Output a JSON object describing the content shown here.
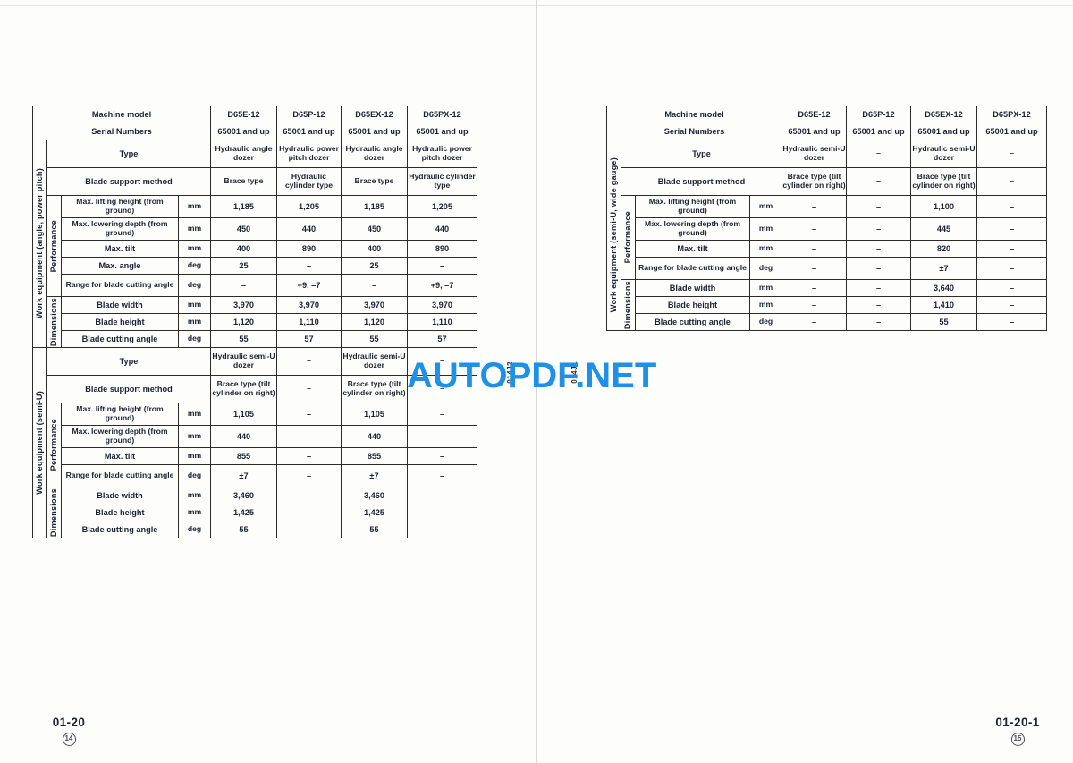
{
  "document": {
    "watermark": "AUTOPDF.NET",
    "watermark_color": "#1e90e8",
    "sheet_code_left": "014J2",
    "sheet_code_right": "014J1"
  },
  "left_page": {
    "footer_page": "01-20",
    "footer_revision": "14",
    "table": {
      "header_rows": [
        {
          "label": "Machine model",
          "values": [
            "D65E-12",
            "D65P-12",
            "D65EX-12",
            "D65PX-12"
          ]
        },
        {
          "label": "Serial Numbers",
          "values": [
            "65001 and up",
            "65001 and up",
            "65001 and up",
            "65001 and up"
          ]
        }
      ],
      "sections": [
        {
          "group_label": "Work equipment (angle, power pitch)",
          "type_row": {
            "label": "Type",
            "values": [
              "Hydraulic angle dozer",
              "Hydraulic power pitch dozer",
              "Hydraulic angle dozer",
              "Hydraulic power pitch dozer"
            ]
          },
          "support_row": {
            "label": "Blade support method",
            "values": [
              "Brace type",
              "Hydraulic cylinder type",
              "Brace type",
              "Hydraulic cylinder type"
            ]
          },
          "subsections": [
            {
              "label": "Performance",
              "rows": [
                {
                  "label": "Max. lifting height (from ground)",
                  "unit": "mm",
                  "values": [
                    "1,185",
                    "1,205",
                    "1,185",
                    "1,205"
                  ]
                },
                {
                  "label": "Max. lowering depth (from ground)",
                  "unit": "mm",
                  "values": [
                    "450",
                    "440",
                    "450",
                    "440"
                  ]
                },
                {
                  "label": "Max. tilt",
                  "unit": "mm",
                  "values": [
                    "400",
                    "890",
                    "400",
                    "890"
                  ]
                },
                {
                  "label": "Max. angle",
                  "unit": "deg",
                  "values": [
                    "25",
                    "–",
                    "25",
                    "–"
                  ]
                },
                {
                  "label": "Range for blade cutting angle",
                  "unit": "deg",
                  "values": [
                    "–",
                    "+9, –7",
                    "–",
                    "+9, –7"
                  ]
                }
              ]
            },
            {
              "label": "Dimensions",
              "rows": [
                {
                  "label": "Blade width",
                  "unit": "mm",
                  "values": [
                    "3,970",
                    "3,970",
                    "3,970",
                    "3,970"
                  ]
                },
                {
                  "label": "Blade height",
                  "unit": "mm",
                  "values": [
                    "1,120",
                    "1,110",
                    "1,120",
                    "1,110"
                  ]
                },
                {
                  "label": "Blade cutting angle",
                  "unit": "deg",
                  "values": [
                    "55",
                    "57",
                    "55",
                    "57"
                  ]
                }
              ]
            }
          ]
        },
        {
          "group_label": "Work equipment (semi-U)",
          "type_row": {
            "label": "Type",
            "values": [
              "Hydraulic semi-U dozer",
              "–",
              "Hydraulic semi-U dozer",
              "–"
            ]
          },
          "support_row": {
            "label": "Blade support method",
            "values": [
              "Brace type (tilt cylinder on right)",
              "–",
              "Brace type (tilt cylinder on right)",
              "–"
            ]
          },
          "subsections": [
            {
              "label": "Performance",
              "rows": [
                {
                  "label": "Max. lifting height (from ground)",
                  "unit": "mm",
                  "values": [
                    "1,105",
                    "–",
                    "1,105",
                    "–"
                  ]
                },
                {
                  "label": "Max. lowering depth (from ground)",
                  "unit": "mm",
                  "values": [
                    "440",
                    "–",
                    "440",
                    "–"
                  ]
                },
                {
                  "label": "Max. tilt",
                  "unit": "mm",
                  "values": [
                    "855",
                    "–",
                    "855",
                    "–"
                  ]
                },
                {
                  "label": "Range for blade cutting angle",
                  "unit": "deg",
                  "values": [
                    "±7",
                    "–",
                    "±7",
                    "–"
                  ]
                }
              ]
            },
            {
              "label": "Dimensions",
              "rows": [
                {
                  "label": "Blade width",
                  "unit": "mm",
                  "values": [
                    "3,460",
                    "–",
                    "3,460",
                    "–"
                  ]
                },
                {
                  "label": "Blade height",
                  "unit": "mm",
                  "values": [
                    "1,425",
                    "–",
                    "1,425",
                    "–"
                  ]
                },
                {
                  "label": "Blade cutting angle",
                  "unit": "deg",
                  "values": [
                    "55",
                    "–",
                    "55",
                    "–"
                  ]
                }
              ]
            }
          ]
        }
      ]
    }
  },
  "right_page": {
    "footer_page": "01-20-1",
    "footer_revision": "15",
    "table": {
      "header_rows": [
        {
          "label": "Machine model",
          "values": [
            "D65E-12",
            "D65P-12",
            "D65EX-12",
            "D65PX-12"
          ]
        },
        {
          "label": "Serial Numbers",
          "values": [
            "65001 and up",
            "65001 and up",
            "65001 and up",
            "65001 and up"
          ]
        }
      ],
      "sections": [
        {
          "group_label": "Work equipment (semi-U, wide gauge)",
          "type_row": {
            "label": "Type",
            "values": [
              "Hydraulic semi-U dozer",
              "–",
              "Hydraulic semi-U dozer",
              "–"
            ]
          },
          "support_row": {
            "label": "Blade support method",
            "values": [
              "Brace type (tilt cylinder on right)",
              "–",
              "Brace type (tilt cylinder on right)",
              "–"
            ]
          },
          "subsections": [
            {
              "label": "Performance",
              "rows": [
                {
                  "label": "Max. lifting height (from ground)",
                  "unit": "mm",
                  "values": [
                    "–",
                    "–",
                    "1,100",
                    "–"
                  ]
                },
                {
                  "label": "Max. lowering depth (from ground)",
                  "unit": "mm",
                  "values": [
                    "–",
                    "–",
                    "445",
                    "–"
                  ]
                },
                {
                  "label": "Max. tilt",
                  "unit": "mm",
                  "values": [
                    "–",
                    "–",
                    "820",
                    "–"
                  ]
                },
                {
                  "label": "Range for blade cutting angle",
                  "unit": "deg",
                  "values": [
                    "–",
                    "–",
                    "±7",
                    "–"
                  ]
                }
              ]
            },
            {
              "label": "Dimensions",
              "rows": [
                {
                  "label": "Blade width",
                  "unit": "mm",
                  "values": [
                    "–",
                    "–",
                    "3,640",
                    "–"
                  ]
                },
                {
                  "label": "Blade height",
                  "unit": "mm",
                  "values": [
                    "–",
                    "–",
                    "1,410",
                    "–"
                  ]
                },
                {
                  "label": "Blade cutting angle",
                  "unit": "deg",
                  "values": [
                    "–",
                    "–",
                    "55",
                    "–"
                  ]
                }
              ]
            }
          ]
        }
      ]
    }
  }
}
